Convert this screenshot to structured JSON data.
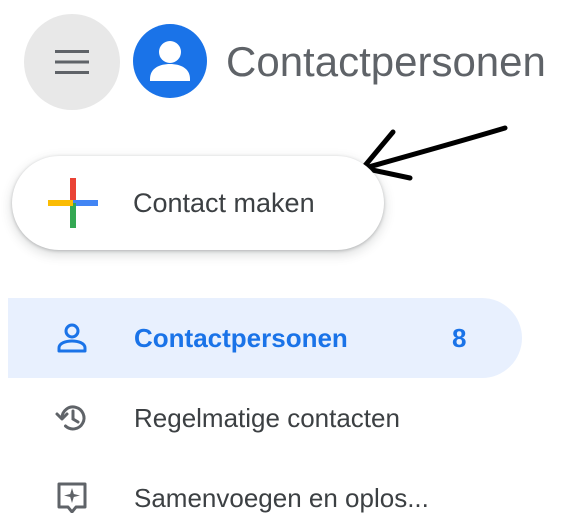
{
  "header": {
    "title": "Contactpersonen"
  },
  "create": {
    "label": "Contact maken"
  },
  "nav": {
    "items": [
      {
        "label": "Contactpersonen",
        "count": "8",
        "active": true,
        "icon": "person-icon"
      },
      {
        "label": "Regelmatige contacten",
        "active": false,
        "icon": "history-icon"
      },
      {
        "label": "Samenvoegen en oplos...",
        "active": false,
        "icon": "merge-fix-icon"
      }
    ]
  },
  "colors": {
    "accent": "#1a73e8",
    "active_bg": "#e8f0fe",
    "text": "#3c4043",
    "title_text": "#5f6368",
    "menu_bg": "#e8e8e8",
    "plus_red": "#ea4335",
    "plus_blue": "#4285f4",
    "plus_green": "#34a853",
    "plus_yellow": "#fbbc04"
  }
}
